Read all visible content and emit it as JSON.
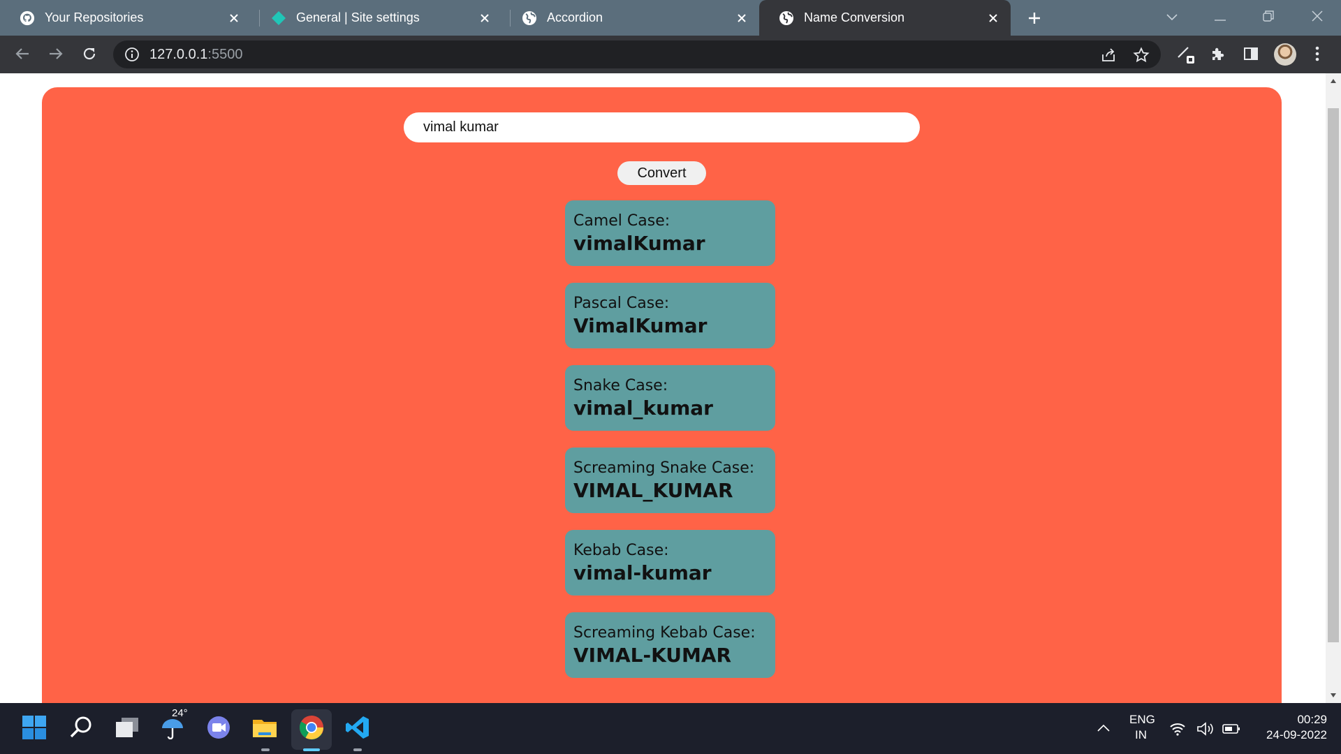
{
  "browser": {
    "tabs": [
      {
        "title": "Your Repositories",
        "icon": "github-icon",
        "active": false
      },
      {
        "title": "General | Site settings",
        "icon": "netlify-icon",
        "active": false
      },
      {
        "title": "Accordion",
        "icon": "globe-icon",
        "active": false
      },
      {
        "title": "Name Conversion",
        "icon": "globe-icon",
        "active": true
      }
    ],
    "url_host": "127.0.0.1",
    "url_port": ":5500"
  },
  "page": {
    "input_value": "vimal kumar",
    "convert_label": "Convert",
    "results": [
      {
        "label": "Camel Case:",
        "value": "vimalKumar"
      },
      {
        "label": "Pascal Case:",
        "value": "VimalKumar"
      },
      {
        "label": "Snake Case:",
        "value": "vimal_kumar"
      },
      {
        "label": "Screaming Snake Case:",
        "value": "VIMAL_KUMAR"
      },
      {
        "label": "Kebab Case:",
        "value": "vimal-kumar"
      },
      {
        "label": "Screaming Kebab Case:",
        "value": "VIMAL-KUMAR"
      }
    ],
    "colors": {
      "background": "#ff6347",
      "card": "#5f9ea0"
    }
  },
  "taskbar": {
    "weather_temp": "24°",
    "language": "ENG",
    "region": "IN",
    "time": "00:29",
    "date": "24-09-2022"
  }
}
